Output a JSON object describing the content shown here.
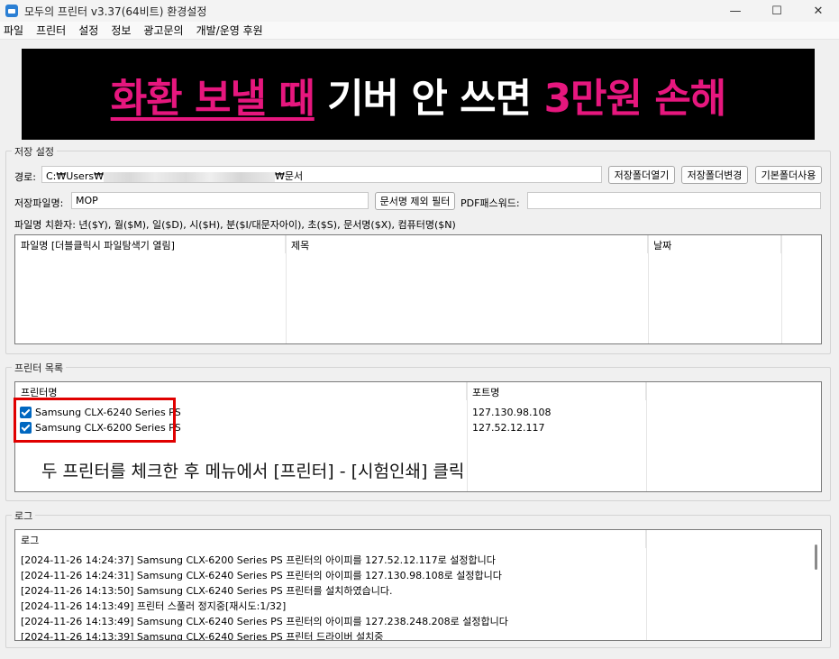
{
  "window": {
    "title": "모두의 프린터 v3.37(64비트) 환경설정",
    "minimize": "—",
    "maximize": "☐",
    "close": "✕"
  },
  "menu": [
    "파일",
    "프린터",
    "설정",
    "정보",
    "광고문의",
    "개발/운영 후원"
  ],
  "banner": {
    "part1": "화환 보낼 때",
    "part2": "기버 안 쓰면",
    "part3": "3만원 손해"
  },
  "save_settings": {
    "group_label": "저장 설정",
    "path_label": "경로:",
    "path_prefix": "C:₩Users₩",
    "path_suffix": "₩문서",
    "btn_open_folder": "저장폴더열기",
    "btn_change_folder": "저장폴더변경",
    "btn_default_folder": "기본폴더사용",
    "filename_label": "저장파일명:",
    "filename_value": "MOP",
    "btn_filter": "문서명 제외 필터",
    "pdf_password_label": "PDF패스워드:",
    "pdf_password_value": "",
    "substitutes": "파일명 치환자: 년($Y), 월($M), 일($D), 시($H), 분($I/대문자아이), 초($S), 문서명($X), 컴퓨터명($N)",
    "columns": [
      "파일명 [더블클릭시 파일탐색기 열림]",
      "제목",
      "날짜"
    ]
  },
  "printers": {
    "group_label": "프린터 목록",
    "columns": [
      "프린터명",
      "포트명"
    ],
    "rows": [
      {
        "name": "Samsung CLX-6240 Series PS",
        "port": "127.130.98.108",
        "checked": true
      },
      {
        "name": "Samsung CLX-6200 Series PS",
        "port": "127.52.12.117",
        "checked": true
      }
    ],
    "instruction": "두 프린터를 체크한 후 메뉴에서 [프린터] - [시험인쇄] 클릭"
  },
  "log": {
    "group_label": "로그",
    "column": "로그",
    "entries": [
      "[2024-11-26 14:24:37] Samsung CLX-6200 Series PS 프린터의 아이피를 127.52.12.117로 설정합니다",
      "[2024-11-26 14:24:31] Samsung CLX-6240 Series PS 프린터의 아이피를 127.130.98.108로 설정합니다",
      "[2024-11-26 14:13:50] Samsung CLX-6240 Series PS 프린터를 설치하였습니다.",
      "[2024-11-26 14:13:49] 프린터 스풀러 정지중[재시도:1/32]",
      "[2024-11-26 14:13:49] Samsung CLX-6240 Series PS 프린터의 아이피를 127.238.248.208로 설정합니다",
      "[2024-11-26 14:13:39] Samsung CLX-6240 Series PS 프린터 드라이버 설치중"
    ]
  },
  "colors": {
    "accent": "#0067c0",
    "banner_pink": "#e6177e",
    "highlight": "#e00000"
  }
}
